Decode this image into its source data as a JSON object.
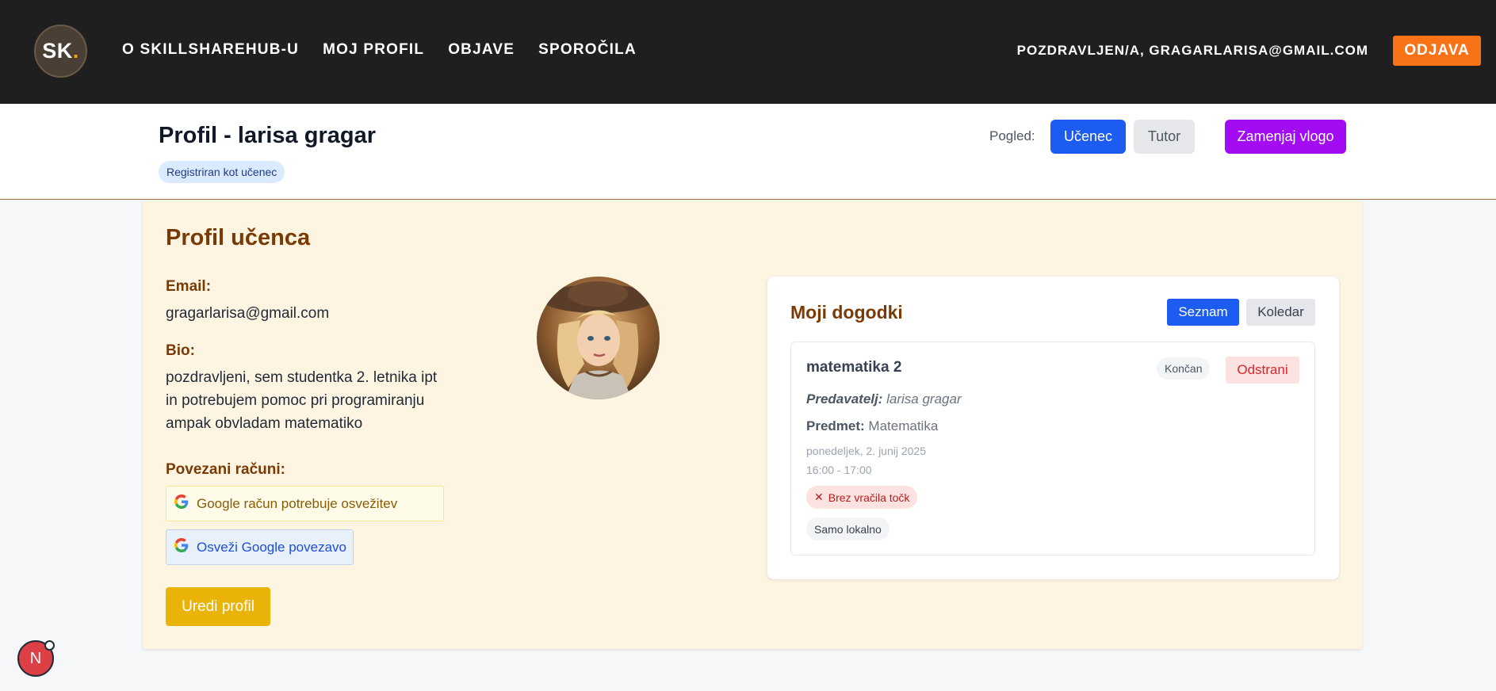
{
  "navbar": {
    "logo_text": "SK",
    "logo_dot": ".",
    "links": [
      "O SKILLSHAREHUB-U",
      "MOJ PROFIL",
      "OBJAVE",
      "SPOROČILA"
    ],
    "greeting": "POZDRAVLJEN/A, GRAGARLARISA@GMAIL.COM",
    "logout_label": "ODJAVA"
  },
  "header": {
    "title": "Profil - larisa gragar",
    "registered_badge": "Registriran kot učenec",
    "view_label": "Pogled:",
    "view_student": "Učenec",
    "view_tutor": "Tutor",
    "switch_role": "Zamenjaj vlogo"
  },
  "profile": {
    "section_title": "Profil učenca",
    "email_label": "Email:",
    "email_value": "gragarlarisa@gmail.com",
    "bio_label": "Bio:",
    "bio_lines": [
      "pozdravljeni, sem studentka 2. letnika ipt",
      "in potrebujem pomoc pri programiranju",
      "ampak obvladam matematiko"
    ],
    "accounts_label": "Povezani računi:",
    "google_warning": "Google račun potrebuje osvežitev",
    "google_refresh": "Osveži Google povezavo",
    "edit_label": "Uredi profil"
  },
  "events": {
    "title": "Moji dogodki",
    "list_label": "Seznam",
    "calendar_label": "Koledar",
    "items": [
      {
        "name": "matematika 2",
        "status": "Končan",
        "remove_label": "Odstrani",
        "lecturer_label": "Predavatelj:",
        "lecturer": "larisa gragar",
        "subject_label": "Predmet:",
        "subject": "Matematika",
        "date": "ponedeljek, 2. junij 2025",
        "time": "16:00 - 17:00",
        "points_badge": "Brez vračila točk",
        "local_badge": "Samo lokalno"
      }
    ]
  },
  "bubble": {
    "letter": "N"
  },
  "colors": {
    "navbar_bg": "#1f1f1f",
    "accent_orange": "#f97316",
    "primary_blue": "#1d5cf0",
    "role_purple": "#a30bf2",
    "profile_brown": "#7a3a06",
    "card_bg": "#fdf5e1",
    "edit_yellow": "#eab308"
  }
}
